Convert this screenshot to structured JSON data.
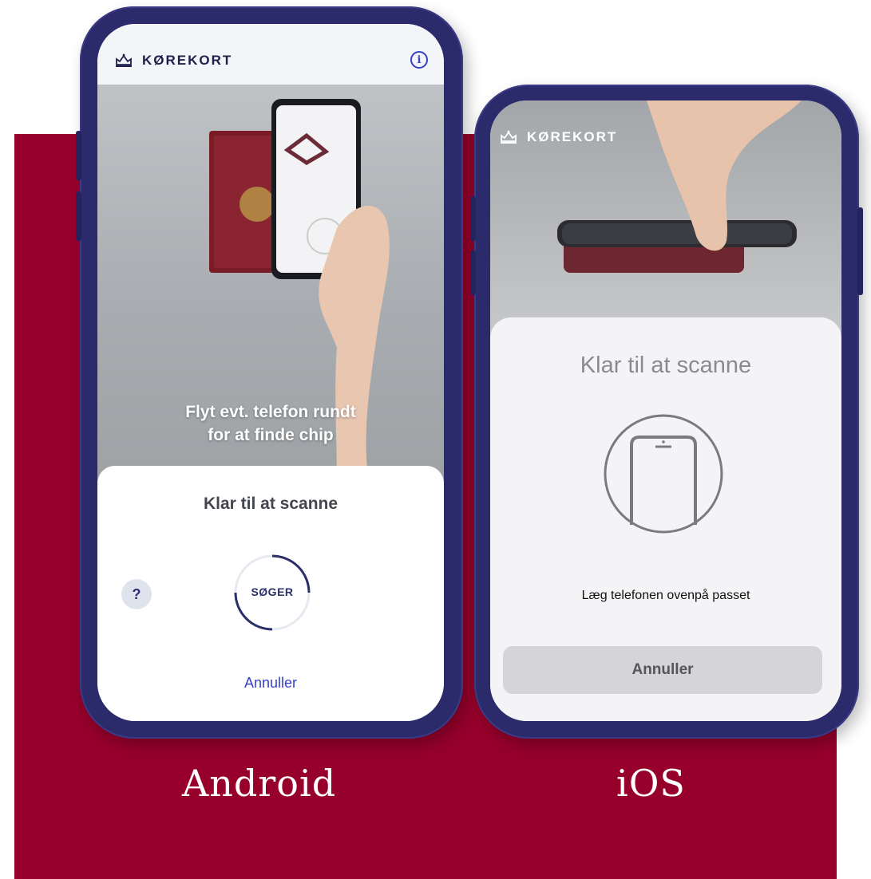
{
  "colors": {
    "backdrop": "#96002a",
    "phone_frame": "#2b2a6b",
    "accent": "#3540c8"
  },
  "labels": {
    "android": "Android",
    "ios": "iOS"
  },
  "android": {
    "brand": "KØREKORT",
    "hint_line1": "Flyt evt. telefon rundt",
    "hint_line2": "for at finde chip",
    "title": "Klar til at scanne",
    "help": "?",
    "status": "SØGER",
    "cancel": "Annuller"
  },
  "ios": {
    "brand": "KØREKORT",
    "title": "Klar til at scanne",
    "instruction": "Læg telefonen ovenpå passet",
    "cancel": "Annuller"
  }
}
